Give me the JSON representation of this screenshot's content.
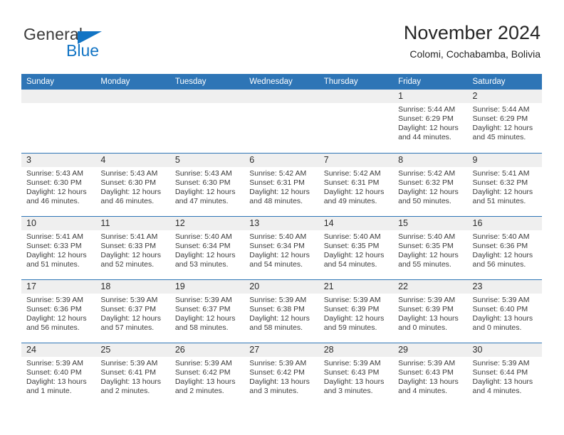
{
  "brand": {
    "name_part1": "General",
    "name_part2": "Blue",
    "logo_icon": "triangle-icon",
    "colors": {
      "blue": "#1274c4",
      "dark": "#3a3a3a"
    }
  },
  "header": {
    "title": "November 2024",
    "subtitle": "Colomi, Cochabamba, Bolivia"
  },
  "theme": {
    "header_blue": "#2e75b6",
    "day_band_gray": "#efefef",
    "text": "#3c3c3c"
  },
  "weekdays": [
    "Sunday",
    "Monday",
    "Tuesday",
    "Wednesday",
    "Thursday",
    "Friday",
    "Saturday"
  ],
  "weeks": [
    [
      {
        "day": "",
        "empty": true
      },
      {
        "day": "",
        "empty": true
      },
      {
        "day": "",
        "empty": true
      },
      {
        "day": "",
        "empty": true
      },
      {
        "day": "",
        "empty": true
      },
      {
        "day": "1",
        "sunrise": "Sunrise: 5:44 AM",
        "sunset": "Sunset: 6:29 PM",
        "daylight": "Daylight: 12 hours and 44 minutes."
      },
      {
        "day": "2",
        "sunrise": "Sunrise: 5:44 AM",
        "sunset": "Sunset: 6:29 PM",
        "daylight": "Daylight: 12 hours and 45 minutes."
      }
    ],
    [
      {
        "day": "3",
        "sunrise": "Sunrise: 5:43 AM",
        "sunset": "Sunset: 6:30 PM",
        "daylight": "Daylight: 12 hours and 46 minutes."
      },
      {
        "day": "4",
        "sunrise": "Sunrise: 5:43 AM",
        "sunset": "Sunset: 6:30 PM",
        "daylight": "Daylight: 12 hours and 46 minutes."
      },
      {
        "day": "5",
        "sunrise": "Sunrise: 5:43 AM",
        "sunset": "Sunset: 6:30 PM",
        "daylight": "Daylight: 12 hours and 47 minutes."
      },
      {
        "day": "6",
        "sunrise": "Sunrise: 5:42 AM",
        "sunset": "Sunset: 6:31 PM",
        "daylight": "Daylight: 12 hours and 48 minutes."
      },
      {
        "day": "7",
        "sunrise": "Sunrise: 5:42 AM",
        "sunset": "Sunset: 6:31 PM",
        "daylight": "Daylight: 12 hours and 49 minutes."
      },
      {
        "day": "8",
        "sunrise": "Sunrise: 5:42 AM",
        "sunset": "Sunset: 6:32 PM",
        "daylight": "Daylight: 12 hours and 50 minutes."
      },
      {
        "day": "9",
        "sunrise": "Sunrise: 5:41 AM",
        "sunset": "Sunset: 6:32 PM",
        "daylight": "Daylight: 12 hours and 51 minutes."
      }
    ],
    [
      {
        "day": "10",
        "sunrise": "Sunrise: 5:41 AM",
        "sunset": "Sunset: 6:33 PM",
        "daylight": "Daylight: 12 hours and 51 minutes."
      },
      {
        "day": "11",
        "sunrise": "Sunrise: 5:41 AM",
        "sunset": "Sunset: 6:33 PM",
        "daylight": "Daylight: 12 hours and 52 minutes."
      },
      {
        "day": "12",
        "sunrise": "Sunrise: 5:40 AM",
        "sunset": "Sunset: 6:34 PM",
        "daylight": "Daylight: 12 hours and 53 minutes."
      },
      {
        "day": "13",
        "sunrise": "Sunrise: 5:40 AM",
        "sunset": "Sunset: 6:34 PM",
        "daylight": "Daylight: 12 hours and 54 minutes."
      },
      {
        "day": "14",
        "sunrise": "Sunrise: 5:40 AM",
        "sunset": "Sunset: 6:35 PM",
        "daylight": "Daylight: 12 hours and 54 minutes."
      },
      {
        "day": "15",
        "sunrise": "Sunrise: 5:40 AM",
        "sunset": "Sunset: 6:35 PM",
        "daylight": "Daylight: 12 hours and 55 minutes."
      },
      {
        "day": "16",
        "sunrise": "Sunrise: 5:40 AM",
        "sunset": "Sunset: 6:36 PM",
        "daylight": "Daylight: 12 hours and 56 minutes."
      }
    ],
    [
      {
        "day": "17",
        "sunrise": "Sunrise: 5:39 AM",
        "sunset": "Sunset: 6:36 PM",
        "daylight": "Daylight: 12 hours and 56 minutes."
      },
      {
        "day": "18",
        "sunrise": "Sunrise: 5:39 AM",
        "sunset": "Sunset: 6:37 PM",
        "daylight": "Daylight: 12 hours and 57 minutes."
      },
      {
        "day": "19",
        "sunrise": "Sunrise: 5:39 AM",
        "sunset": "Sunset: 6:37 PM",
        "daylight": "Daylight: 12 hours and 58 minutes."
      },
      {
        "day": "20",
        "sunrise": "Sunrise: 5:39 AM",
        "sunset": "Sunset: 6:38 PM",
        "daylight": "Daylight: 12 hours and 58 minutes."
      },
      {
        "day": "21",
        "sunrise": "Sunrise: 5:39 AM",
        "sunset": "Sunset: 6:39 PM",
        "daylight": "Daylight: 12 hours and 59 minutes."
      },
      {
        "day": "22",
        "sunrise": "Sunrise: 5:39 AM",
        "sunset": "Sunset: 6:39 PM",
        "daylight": "Daylight: 13 hours and 0 minutes."
      },
      {
        "day": "23",
        "sunrise": "Sunrise: 5:39 AM",
        "sunset": "Sunset: 6:40 PM",
        "daylight": "Daylight: 13 hours and 0 minutes."
      }
    ],
    [
      {
        "day": "24",
        "sunrise": "Sunrise: 5:39 AM",
        "sunset": "Sunset: 6:40 PM",
        "daylight": "Daylight: 13 hours and 1 minute."
      },
      {
        "day": "25",
        "sunrise": "Sunrise: 5:39 AM",
        "sunset": "Sunset: 6:41 PM",
        "daylight": "Daylight: 13 hours and 2 minutes."
      },
      {
        "day": "26",
        "sunrise": "Sunrise: 5:39 AM",
        "sunset": "Sunset: 6:42 PM",
        "daylight": "Daylight: 13 hours and 2 minutes."
      },
      {
        "day": "27",
        "sunrise": "Sunrise: 5:39 AM",
        "sunset": "Sunset: 6:42 PM",
        "daylight": "Daylight: 13 hours and 3 minutes."
      },
      {
        "day": "28",
        "sunrise": "Sunrise: 5:39 AM",
        "sunset": "Sunset: 6:43 PM",
        "daylight": "Daylight: 13 hours and 3 minutes."
      },
      {
        "day": "29",
        "sunrise": "Sunrise: 5:39 AM",
        "sunset": "Sunset: 6:43 PM",
        "daylight": "Daylight: 13 hours and 4 minutes."
      },
      {
        "day": "30",
        "sunrise": "Sunrise: 5:39 AM",
        "sunset": "Sunset: 6:44 PM",
        "daylight": "Daylight: 13 hours and 4 minutes."
      }
    ]
  ]
}
